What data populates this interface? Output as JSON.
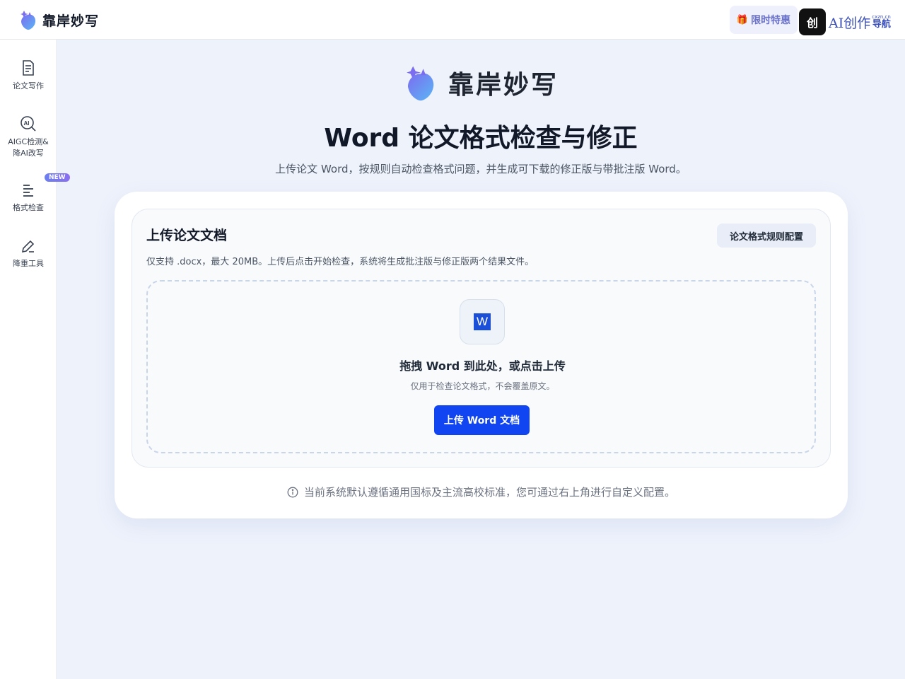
{
  "header": {
    "brand_name": "靠岸妙写",
    "promo_label": "限时特惠",
    "ai_nav_badge": "创",
    "ai_nav_text": "AI创作",
    "ai_nav_sub_small": "cxzn.cn",
    "ai_nav_sub": "导航"
  },
  "sidebar": {
    "items": [
      {
        "label": "论文写作",
        "icon": "document-icon"
      },
      {
        "label": "AIGC检测&\n降AI改写",
        "icon": "ai-search-icon"
      },
      {
        "label": "格式检查",
        "icon": "align-left-icon"
      },
      {
        "label": "降重工具",
        "icon": "pen-icon"
      }
    ],
    "new_badge": "NEW"
  },
  "hero": {
    "brand_name": "靠岸妙写",
    "title": "Word 论文格式检查与修正",
    "subtitle": "上传论文 Word，按规则自动检查格式问题，并生成可下载的修正版与带批注版 Word。"
  },
  "upload": {
    "title": "上传论文文档",
    "rule_button": "论文格式规则配置",
    "description": "仅支持 .docx，最大 20MB。上传后点击开始检查，系统将生成批注版与修正版两个结果文件。",
    "word_icon_letter": "W",
    "drop_title": "拖拽 Word 到此处，或点击上传",
    "drop_subtitle": "仅用于检查论文格式，不会覆盖原文。",
    "upload_button": "上传 Word 文档"
  },
  "note": "当前系统默认遵循通用国标及主流高校标准，您可通过右上角进行自定义配置。",
  "colors": {
    "accent": "#1145f2",
    "background": "#eef2fb",
    "brand_purple": "#6b72c9"
  }
}
